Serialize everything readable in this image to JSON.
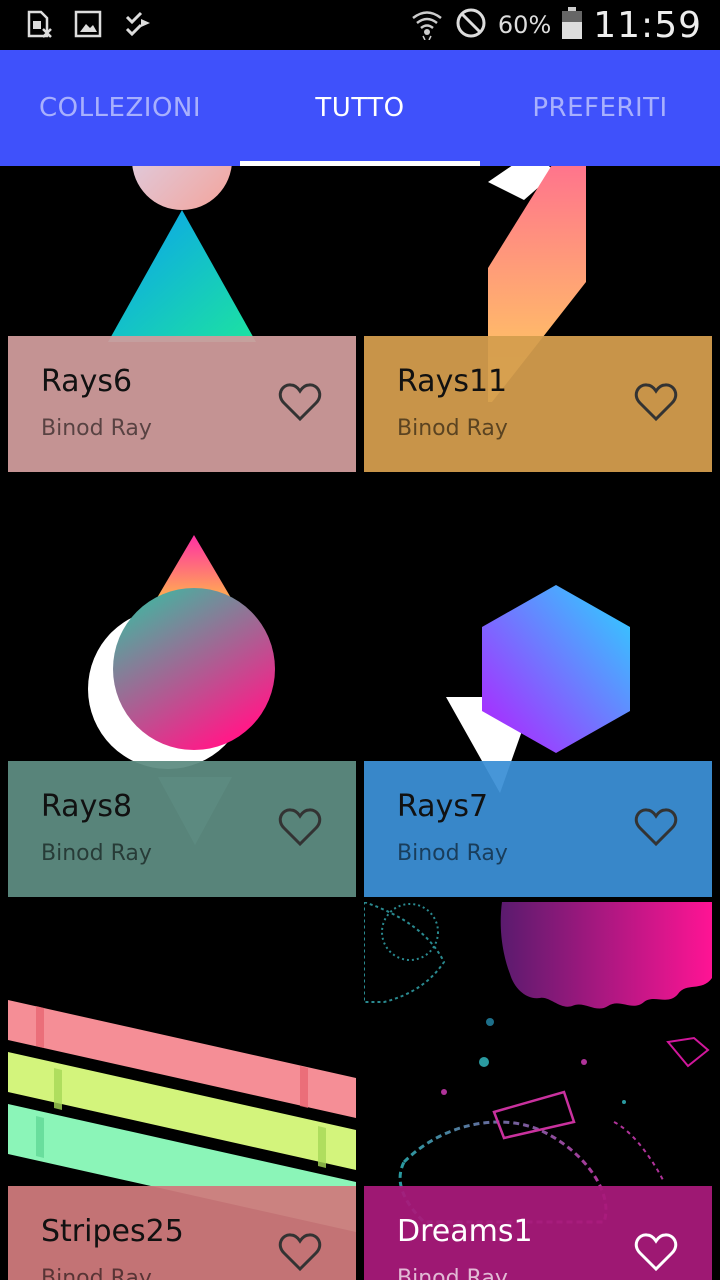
{
  "status_bar": {
    "battery_percent": "60%",
    "time": "11:59",
    "icons": [
      "sim-error-icon",
      "image-icon",
      "checklist-icon",
      "wifi-icon",
      "do-not-disturb-icon",
      "battery-icon"
    ]
  },
  "tabs": [
    {
      "label": "COLLEZIONI",
      "active": false
    },
    {
      "label": "TUTTO",
      "active": true
    },
    {
      "label": "PREFERITI",
      "active": false
    }
  ],
  "colors": {
    "tab_bar": "#3f51fb",
    "background": "#000000"
  },
  "wallpapers": [
    {
      "title": "Rays6",
      "author": "Binod Ray",
      "panel_color": "#d09c9c",
      "favorite_icon": "heart-outline-icon"
    },
    {
      "title": "Rays11",
      "author": "Binod Ray",
      "panel_color": "#d59d4e",
      "favorite_icon": "heart-outline-icon"
    },
    {
      "title": "Rays8",
      "author": "Binod Ray",
      "panel_color": "#5d8c82",
      "favorite_icon": "heart-outline-icon"
    },
    {
      "title": "Rays7",
      "author": "Binod Ray",
      "panel_color": "#3b8fd6",
      "favorite_icon": "heart-outline-icon"
    },
    {
      "title": "Stripes25",
      "author": "Binod Ray",
      "panel_color": "#cf7a7c",
      "favorite_icon": "heart-outline-icon"
    },
    {
      "title": "Dreams1",
      "author": "Binod Ray",
      "panel_color": "#a8197a",
      "favorite_icon": "heart-outline-icon"
    }
  ]
}
